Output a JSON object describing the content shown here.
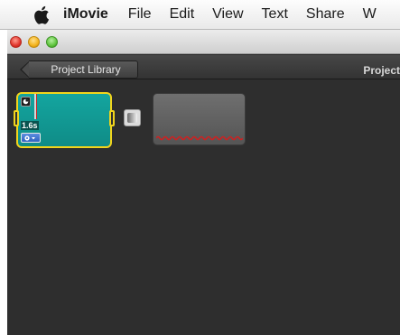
{
  "menubar": {
    "apple_icon": "apple-logo-icon",
    "app_name": "iMovie",
    "items": [
      "File",
      "Edit",
      "View",
      "Text",
      "Share",
      "W"
    ]
  },
  "window": {
    "back_button_label": "Project Library",
    "project_title": "Project"
  },
  "timeline": {
    "selected_clip": {
      "duration": "1.6s",
      "accent_color": "#f2d51c",
      "clip_color": "#14a59f"
    },
    "transition_icon": "transition-icon",
    "placeholder_clip_color": "#666666",
    "audio_wave_color": "#cc2222"
  }
}
